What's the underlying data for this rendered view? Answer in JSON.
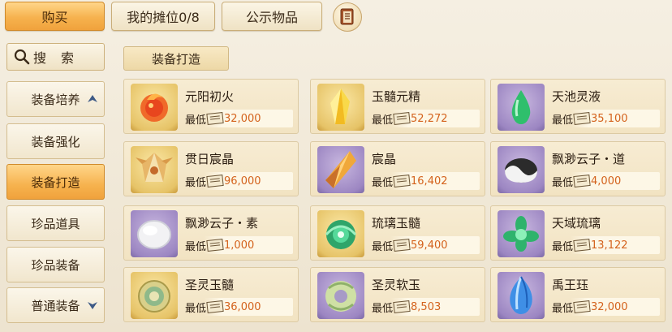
{
  "tabs": {
    "buy": "购买",
    "my_stall": "我的摊位0/8",
    "public_items": "公示物品",
    "mail_icon": "ledger-icon"
  },
  "sidebar": {
    "search_icon": "search-icon",
    "search_label": "搜索",
    "categories": [
      {
        "label": "装备培养",
        "arrow": "up"
      },
      {
        "label": "装备强化"
      },
      {
        "label": "装备打造",
        "active": true
      },
      {
        "label": "珍品道具"
      },
      {
        "label": "珍品装备"
      },
      {
        "label": "普通装备",
        "arrow": "down"
      }
    ]
  },
  "section_tab": "装备打造",
  "price_prefix": "最低",
  "currency_icon": "silver-note-icon",
  "colors": {
    "accent_orange": "#f6b24e",
    "price_orange": "#d4621c"
  },
  "items": [
    {
      "name": "元阳初火",
      "price": "32,000",
      "icon": "fire-orb-icon"
    },
    {
      "name": "玉髓元精",
      "price": "52,272",
      "icon": "yellow-crystal-icon"
    },
    {
      "name": "天池灵液",
      "price": "35,100",
      "icon": "green-droplet-icon"
    },
    {
      "name": "贯日宸晶",
      "price": "96,000",
      "icon": "golden-crystal-icon"
    },
    {
      "name": "宸晶",
      "price": "16,402",
      "icon": "amber-shard-icon"
    },
    {
      "name": "飘渺云子・道",
      "price": "4,000",
      "icon": "yinyang-stone-icon"
    },
    {
      "name": "飘渺云子・素",
      "price": "1,000",
      "icon": "white-stone-icon"
    },
    {
      "name": "琉璃玉髓",
      "price": "59,400",
      "icon": "jade-lotus-icon"
    },
    {
      "name": "天域琉璃",
      "price": "13,122",
      "icon": "jade-flower-icon"
    },
    {
      "name": "圣灵玉髓",
      "price": "36,000",
      "icon": "jade-ring-icon"
    },
    {
      "name": "圣灵软玉",
      "price": "8,503",
      "icon": "jade-disc-icon"
    },
    {
      "name": "禹王珏",
      "price": "32,000",
      "icon": "blue-gem-icon"
    }
  ]
}
